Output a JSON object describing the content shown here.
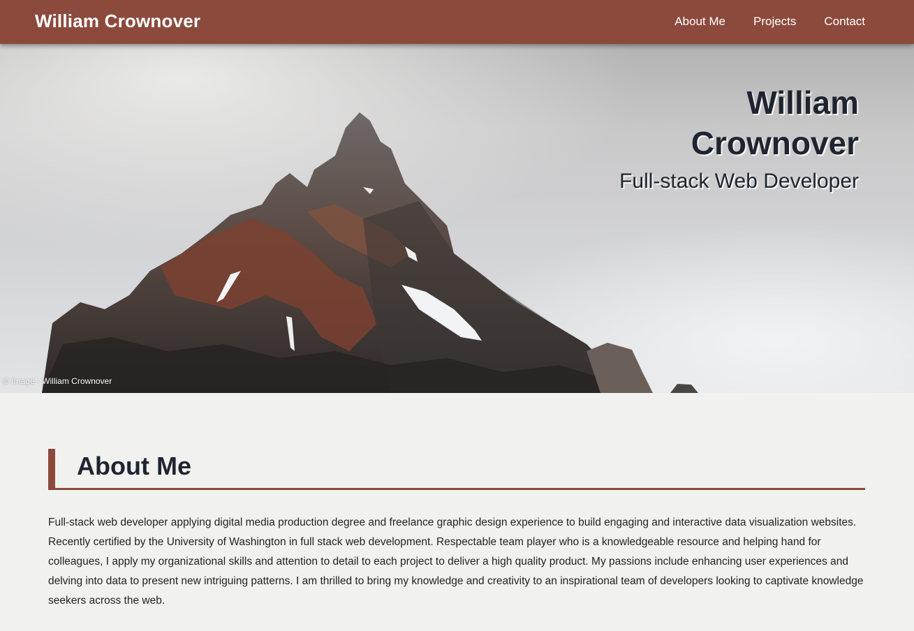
{
  "header": {
    "brand": "William Crownover",
    "nav": [
      {
        "label": "About Me"
      },
      {
        "label": "Projects"
      },
      {
        "label": "Contact"
      }
    ]
  },
  "hero": {
    "title_line1": "William",
    "title_line2": "Crownover",
    "subtitle": "Full-stack Web Developer",
    "credit": "© Image - William Crownover"
  },
  "about": {
    "heading": "About Me",
    "body": "Full-stack web developer applying digital media production degree and freelance graphic design experience to build engaging and interactive data visualization websites. Recently certified by the University of Washington in full stack web development. Respectable team player who is a knowledgeable resource and helping hand for colleagues, I apply my organizational skills and attention to detail to each project to deliver a high quality product. My passions include enhancing user experiences and delving into data to present new intriguing patterns. I am thrilled to bring my knowledge and creativity to an inspirational team of developers looking to captivate knowledge seekers across the web."
  },
  "colors": {
    "accent": "#8b4a3c",
    "text_dark": "#1f2530",
    "page_background": "#f1f2f0"
  }
}
